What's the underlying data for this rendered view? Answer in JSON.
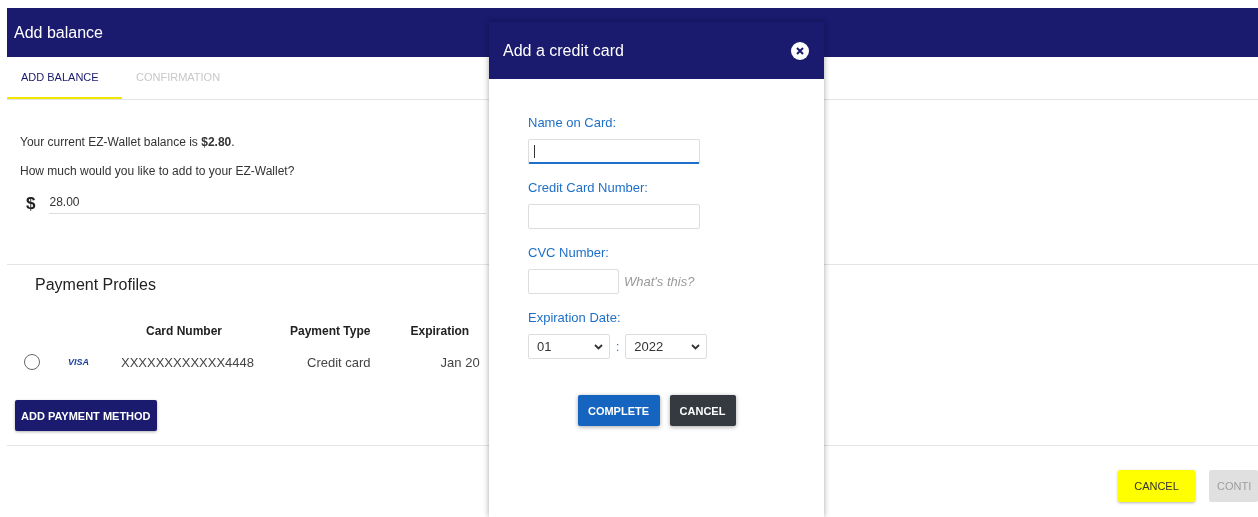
{
  "page": {
    "title": "Add balance",
    "tabs": [
      {
        "label": "ADD BALANCE",
        "selected": true
      },
      {
        "label": "CONFIRMATION",
        "selected": false
      }
    ],
    "balance_text": "Your current EZ-Wallet balance is **$2.80**.",
    "question": "How much would you like to add to your EZ-Wallet?",
    "amount": {
      "currency": "$",
      "value": "28.00"
    },
    "payment_profiles": {
      "title": "Payment Profiles",
      "columns": [
        "Card Number",
        "Payment Type",
        "Expiration"
      ],
      "rows": [
        {
          "selected": false,
          "brand": "VISA",
          "card_number": "XXXXXXXXXXXX4448",
          "payment_type": "Credit card",
          "expiration": "Jan 20"
        }
      ],
      "add_button": "ADD PAYMENT METHOD"
    },
    "buttons": [
      {
        "label": "CANCEL",
        "disabled": false
      },
      {
        "label": "CONTI",
        "disabled": true
      }
    ]
  },
  "dialog": {
    "title": "Add a credit card",
    "fields": [
      {
        "kind": "text",
        "label": "Name on Card:",
        "focused": true
      },
      {
        "kind": "text",
        "label": "Credit Card Number:",
        "focused": false
      },
      {
        "kind": "cvc",
        "label": "CVC Number:",
        "focused": false,
        "hint": "What's this?"
      },
      {
        "kind": "date",
        "label": "Expiration Date:",
        "month": "01",
        "separator": ":",
        "year": "2022"
      }
    ],
    "buttons": [
      {
        "label": "COMPLETE",
        "kind": "primary"
      },
      {
        "label": "CANCEL",
        "kind": "secondary"
      }
    ]
  }
}
